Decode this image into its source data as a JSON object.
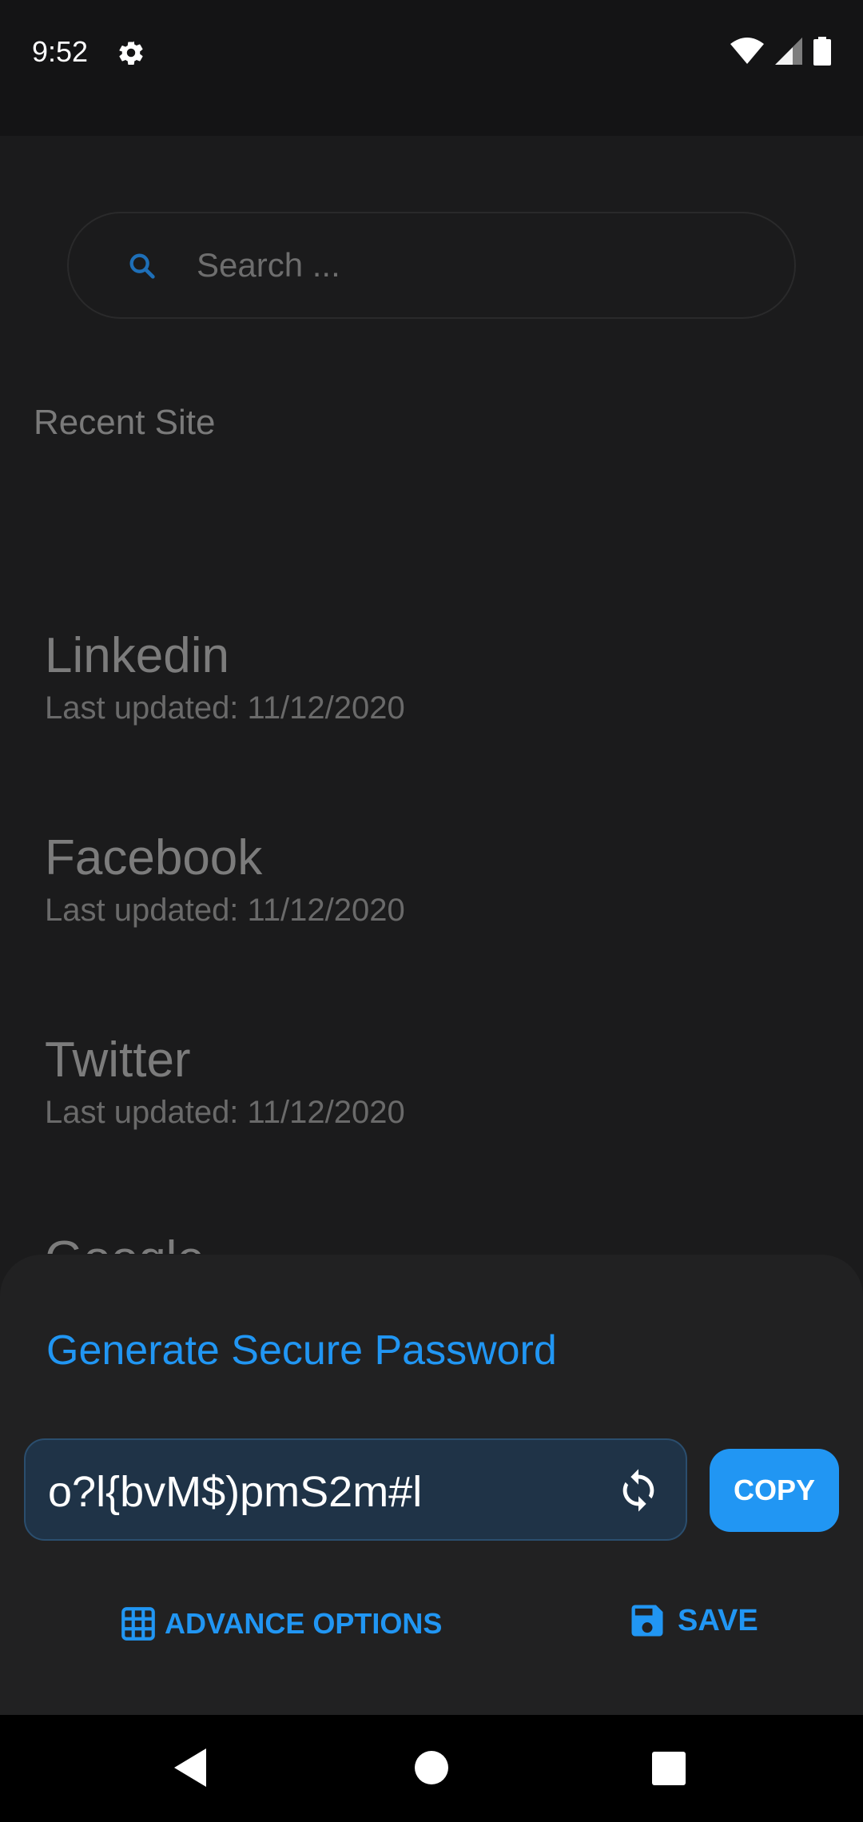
{
  "status_bar": {
    "time": "9:52",
    "icons": [
      "settings-gear-icon",
      "wifi-icon",
      "cellular-signal-icon",
      "battery-icon"
    ]
  },
  "search": {
    "placeholder": "Search ...",
    "icon": "search-icon"
  },
  "recent": {
    "title": "Recent Site",
    "items": [
      {
        "name": "Linkedin",
        "updated": "Last updated: 11/12/2020"
      },
      {
        "name": "Facebook",
        "updated": "Last updated: 11/12/2020"
      },
      {
        "name": "Twitter",
        "updated": "Last updated: 11/12/2020"
      },
      {
        "name": "Google",
        "updated": ""
      }
    ]
  },
  "generator": {
    "title": "Generate Secure Password",
    "password": "o?l{bvM$)pmS2m#l",
    "copy_label": "COPY",
    "advance_label": "ADVANCE OPTIONS",
    "save_label": "SAVE"
  },
  "colors": {
    "accent": "#2196f3",
    "background": "#1b1b1c",
    "sheet": "#212122",
    "field": "#1f3347"
  }
}
